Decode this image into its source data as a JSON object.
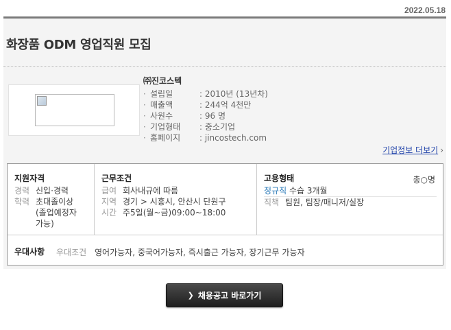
{
  "date": "2022.05.18",
  "job_title": "화장품 ODM 영업직원 모집",
  "company": {
    "name": "㈜진코스텍",
    "info": [
      {
        "key": "설립일",
        "value": ": 2010년 (13년차)"
      },
      {
        "key": "매출액",
        "value": ": 244억 4천만"
      },
      {
        "key": "사원수",
        "value": ": 96 명"
      },
      {
        "key": "기업형태",
        "value": ": 중소기업"
      },
      {
        "key": "홈페이지",
        "value": ": jincostech.com"
      }
    ],
    "more_link": "기업정보 더보기"
  },
  "qualification": {
    "heading": "지원자격",
    "career_key": "경력",
    "career_value": "신입·경력",
    "edu_key": "학력",
    "edu_value": "초대졸이상 (졸업예정자 가능)"
  },
  "conditions": {
    "heading": "근무조건",
    "salary_key": "급여",
    "salary_value": "회사내규에 따름",
    "region_key": "지역",
    "region_value": "경기 > 시흥시, 안산시 단원구",
    "time_key": "시간",
    "time_value": "주5일(월~금)09:00~18:00"
  },
  "employment": {
    "heading": "고용형태",
    "headcount": "총○명",
    "type": "정규직",
    "type_detail": "수습 3개월",
    "position_key": "직책",
    "position_value": "팀원, 팀장/매니저/실장"
  },
  "preference": {
    "heading": "우대사항",
    "key": "우대조건",
    "value": "영어가능자, 중국어가능자, 즉시출근 가능자, 장기근무 가능자"
  },
  "apply_button": "채용공고 바로가기",
  "colors": {
    "link": "#2244aa",
    "employment_type": "#2a7ab8",
    "button": "#2b2b2b"
  }
}
